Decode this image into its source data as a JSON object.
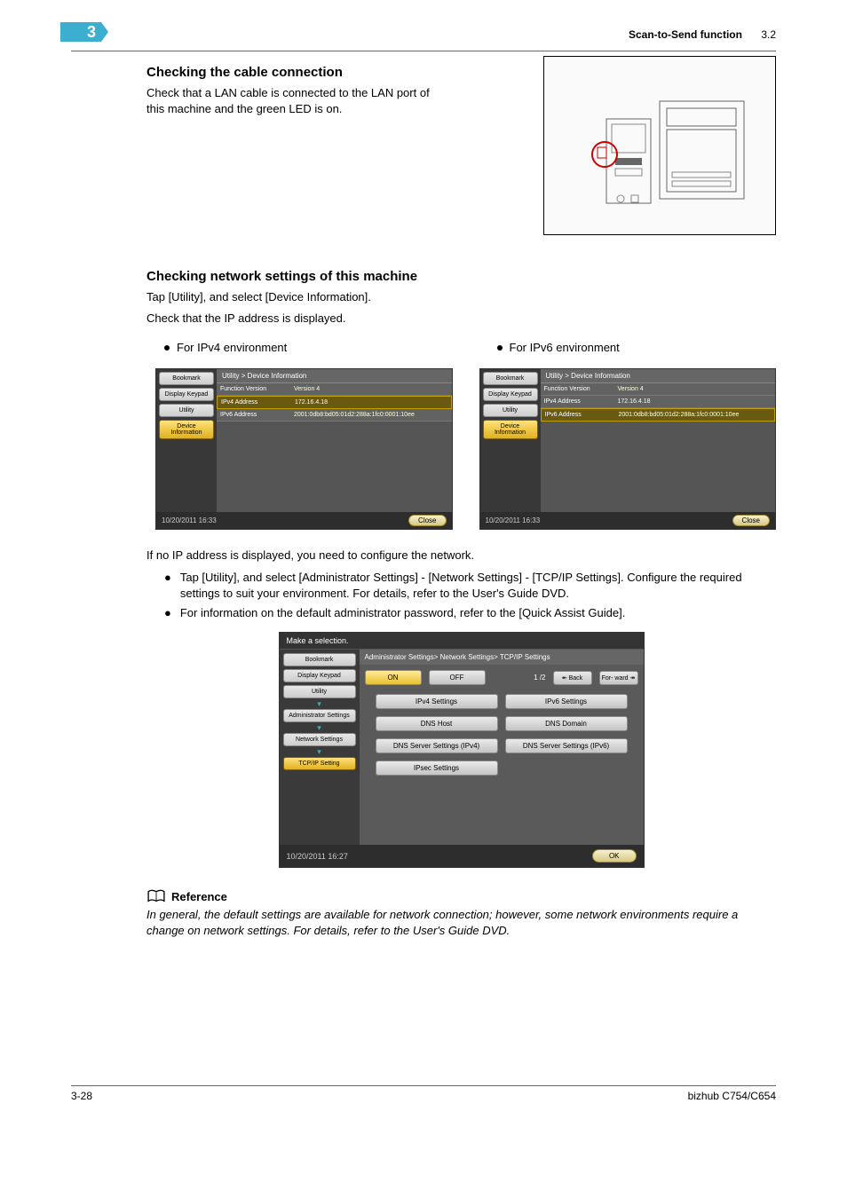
{
  "chapter_num": "3",
  "header": {
    "section": "Scan-to-Send function",
    "num": "3.2"
  },
  "h1": "Checking the cable connection",
  "p1": "Check that a LAN cable is connected to the LAN port of this machine and the green LED is on.",
  "h2": "Checking network settings of this machine",
  "p2a": "Tap [Utility], and select [Device Information].",
  "p2b": "Check that the IP address is displayed.",
  "env4": "For IPv4 environment",
  "env6": "For IPv6 environment",
  "screen": {
    "sidebar": {
      "bookmark": "Bookmark",
      "display": "Display Keypad",
      "utility": "Utility",
      "device": "Device Information"
    },
    "path": "Utility > Device Information",
    "rows": {
      "fv_label": "Function Version",
      "fv_val": "Version 4",
      "ip4_label": "IPv4 Address",
      "ip4_val": "172.16.4.18",
      "ip6_label": "IPv6 Address",
      "ip6_val": "2001:0db8:bd05:01d2:288a:1fc0:0001:10ee"
    },
    "datetime": "10/20/2011   16:33",
    "close": "Close"
  },
  "p3": "If no IP address is displayed, you need to configure the network.",
  "li1": "Tap [Utility], and select [Administrator Settings] - [Network Settings] - [TCP/IP Settings]. Configure the required settings to suit your environment. For details, refer to the User's Guide DVD.",
  "li2": "For information on the default administrator password, refer to the [Quick Assist Guide].",
  "admin": {
    "make": "Make a selection.",
    "side": {
      "bookmark": "Bookmark",
      "display": "Display Keypad",
      "utility": "Utility",
      "as": "Administrator Settings",
      "ns": "Network Settings",
      "tcp": "TCP/IP Setting"
    },
    "path": "Administrator Settings> Network Settings> TCP/IP Settings",
    "on": "ON",
    "off": "OFF",
    "page": "1 /2",
    "back": "Back",
    "fwd": "For- ward",
    "btns": {
      "ipv4": "IPv4 Settings",
      "ipv6": "IPv6 Settings",
      "dnsh": "DNS Host",
      "dnsd": "DNS Domain",
      "dns4": "DNS Server Settings (IPv4)",
      "dns6": "DNS Server Settings (IPv6)",
      "ipsec": "IPsec Settings"
    },
    "datetime": "10/20/2011    16:27",
    "ok": "OK"
  },
  "ref_title": "Reference",
  "ref_body": "In general, the default settings are available for network connection; however, some network environments require a change on network settings. For details, refer to the User's Guide DVD.",
  "footer": {
    "left": "3-28",
    "right": "bizhub C754/C654"
  }
}
